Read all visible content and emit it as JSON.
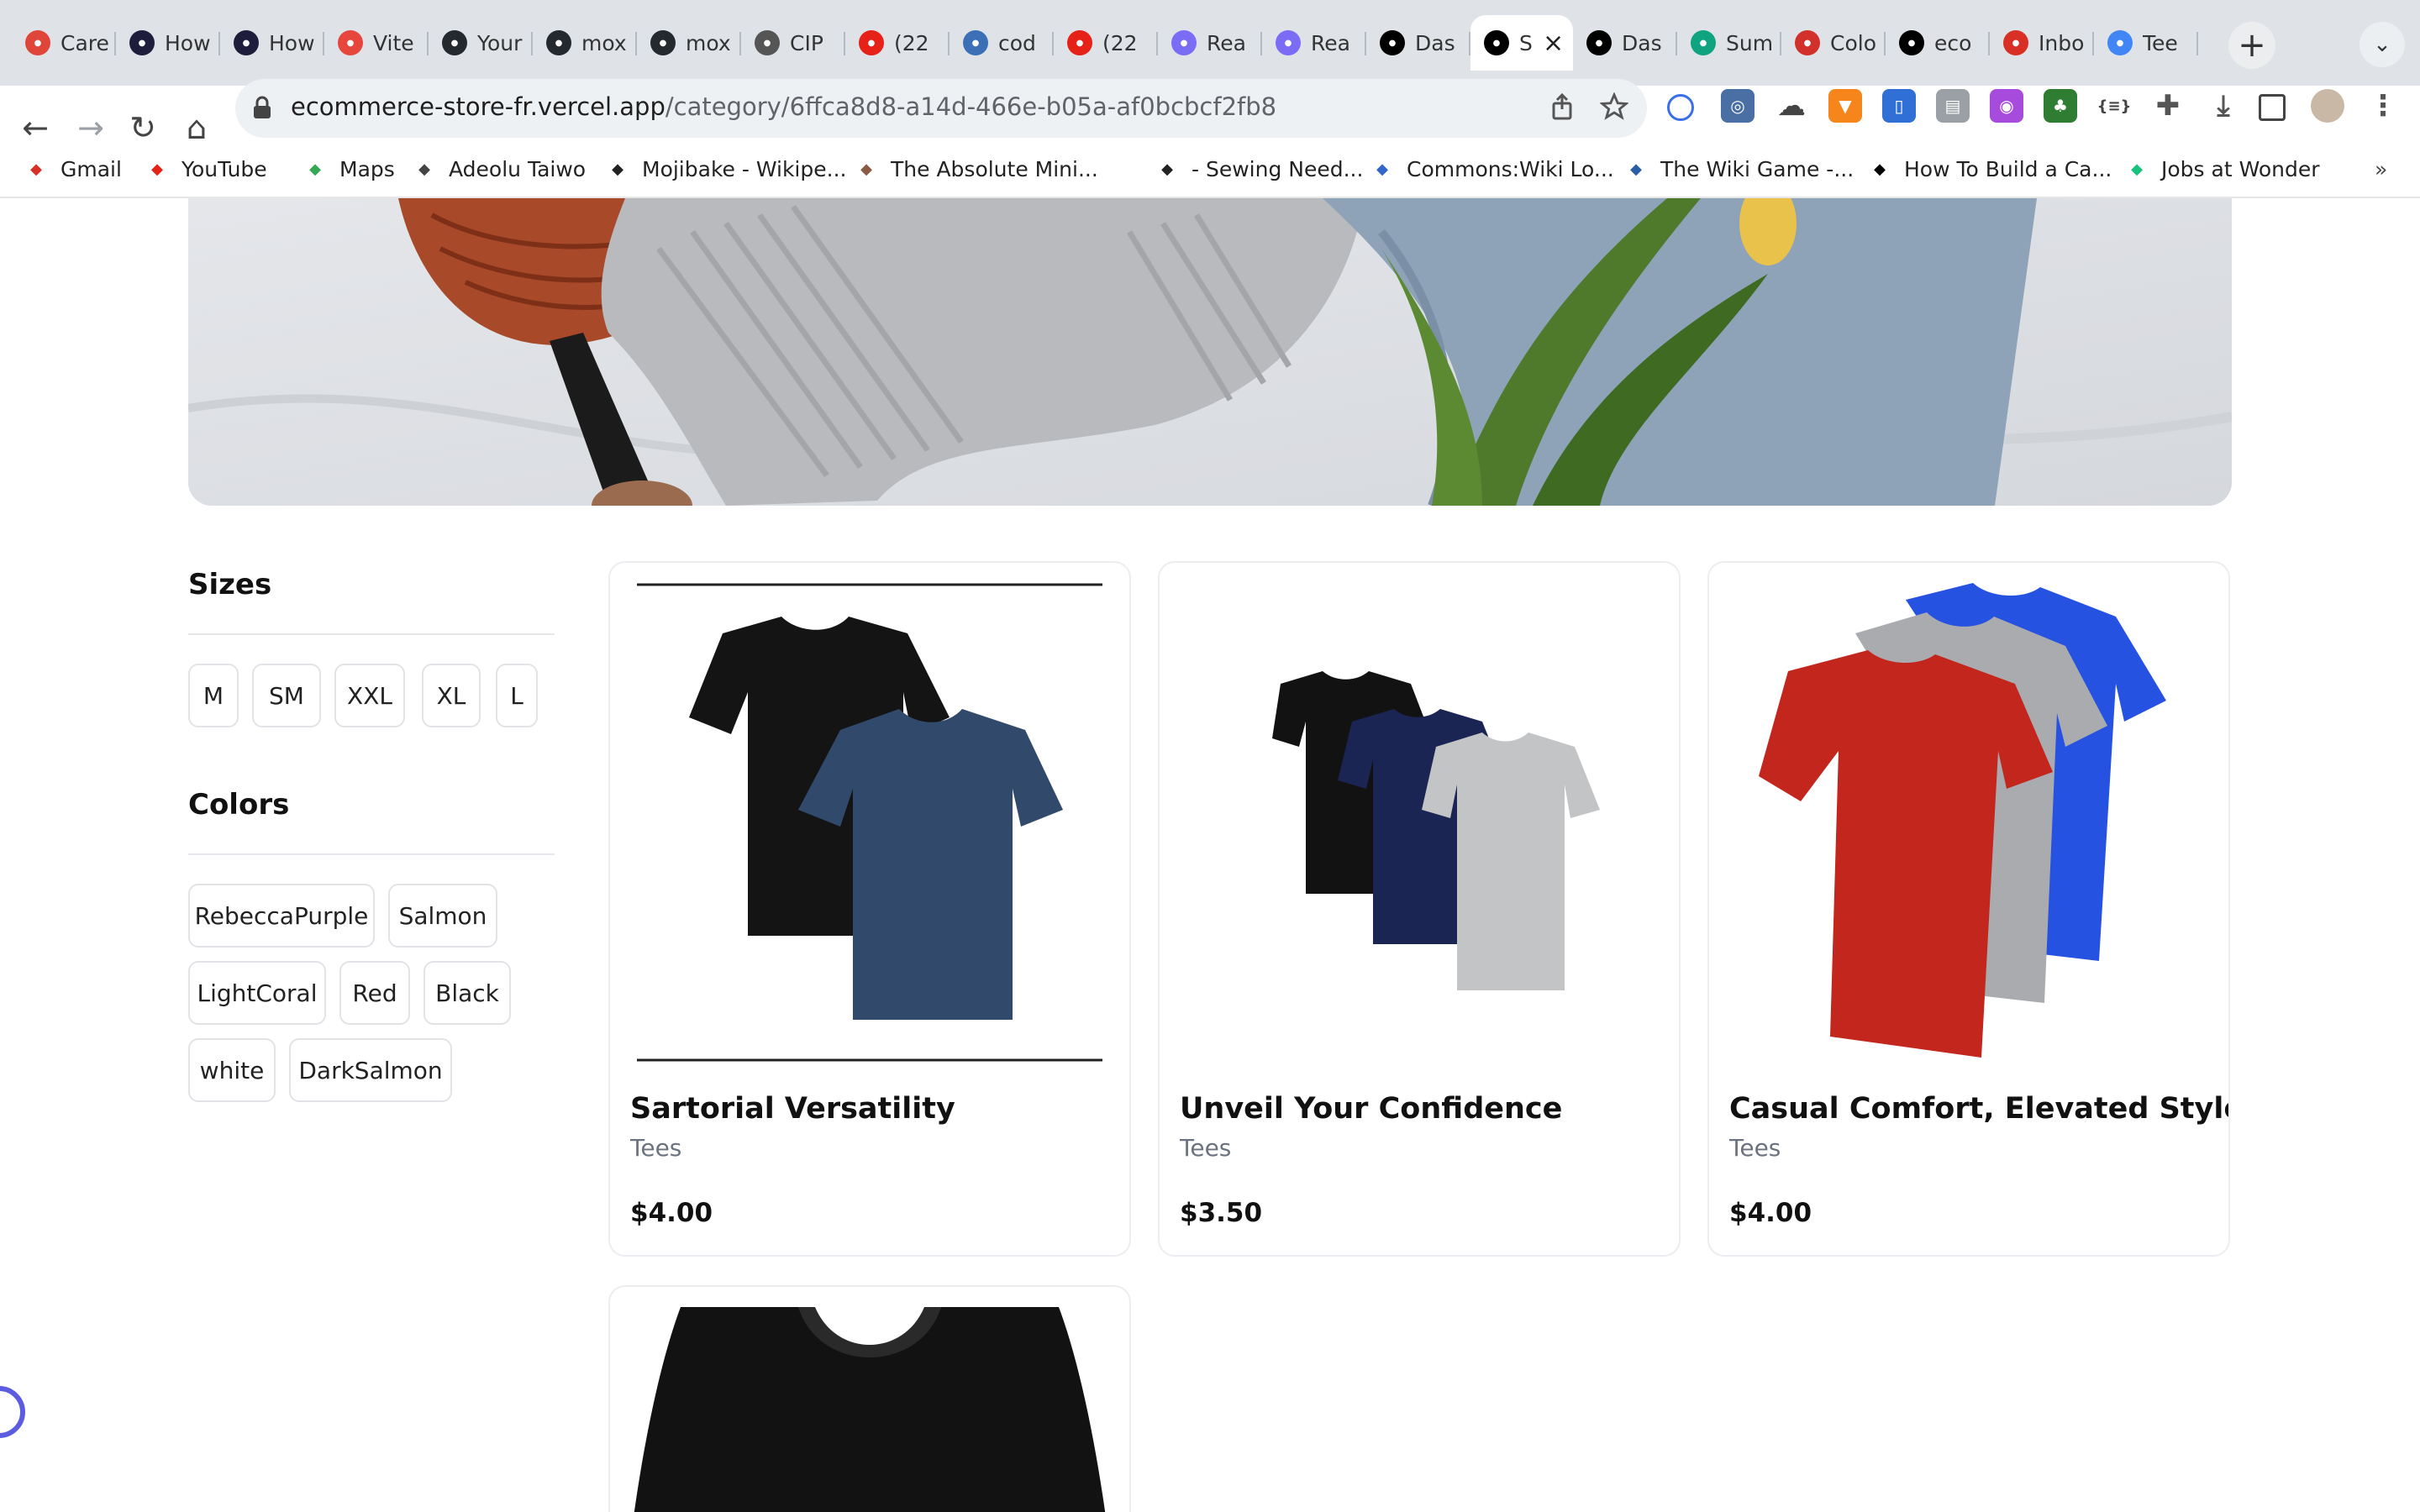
{
  "browser": {
    "tabs": [
      {
        "label": "Care",
        "icon": "care-icon",
        "color": "#e0453a"
      },
      {
        "label": "How",
        "icon": "dev-icon",
        "color": "#1e1e3c"
      },
      {
        "label": "How",
        "icon": "dev-icon",
        "color": "#1e1e3c"
      },
      {
        "label": "Vite",
        "icon": "vite-icon",
        "color": "#e6463c"
      },
      {
        "label": "Your",
        "icon": "github-icon",
        "color": "#24292f"
      },
      {
        "label": "mox",
        "icon": "github-icon",
        "color": "#24292f"
      },
      {
        "label": "mox",
        "icon": "github-icon",
        "color": "#24292f"
      },
      {
        "label": "CIP",
        "icon": "cip-icon",
        "color": "#555555"
      },
      {
        "label": "(22",
        "icon": "youtube-icon",
        "color": "#e62117"
      },
      {
        "label": "cod",
        "icon": "code-icon",
        "color": "#3b6fb6"
      },
      {
        "label": "(22",
        "icon": "youtube-icon",
        "color": "#e62117"
      },
      {
        "label": "Rea",
        "icon": "rocket-icon",
        "color": "#7b6cf5"
      },
      {
        "label": "Rea",
        "icon": "rocket-icon",
        "color": "#7b6cf5"
      },
      {
        "label": "Das",
        "icon": "vercel-icon",
        "color": "#000000"
      },
      {
        "label": "S",
        "icon": "vercel-icon",
        "color": "#000000",
        "active": true
      },
      {
        "label": "Das",
        "icon": "vercel-icon",
        "color": "#000000"
      },
      {
        "label": "Sum",
        "icon": "openai-icon",
        "color": "#10a37f"
      },
      {
        "label": "Colo",
        "icon": "color-icon",
        "color": "#d1302b"
      },
      {
        "label": "eco",
        "icon": "vercel-icon",
        "color": "#000000"
      },
      {
        "label": "Inbo",
        "icon": "gmail-icon",
        "color": "#d93025"
      },
      {
        "label": "Tee",
        "icon": "google-icon",
        "color": "#4285f4"
      }
    ],
    "url_host": "ecommerce-store-fr.vercel.app",
    "url_path": "/category/6ffca8d8-a14d-466e-b05a-af0bcbcf2fb8",
    "bookmarks": [
      {
        "label": "Gmail",
        "icon": "gmail-icon",
        "color": "#d93025"
      },
      {
        "label": "YouTube",
        "icon": "youtube-icon",
        "color": "#e62117"
      },
      {
        "label": "Maps",
        "icon": "maps-icon",
        "color": "#34a853"
      },
      {
        "label": "Adeolu Taiwo",
        "icon": "globe-icon",
        "color": "#444444"
      },
      {
        "label": "Mojibake - Wikipe...",
        "icon": "wikipedia-icon",
        "color": "#222222"
      },
      {
        "label": "The Absolute Mini...",
        "icon": "avatar-icon",
        "color": "#8a5a44"
      },
      {
        "label": "- Sewing Need...",
        "icon": "needle-icon",
        "color": "#222222"
      },
      {
        "label": "Commons:Wiki Lo...",
        "icon": "commons-icon",
        "color": "#3366cc"
      },
      {
        "label": "The Wiki Game -...",
        "icon": "wikigame-icon",
        "color": "#2a5fa8"
      },
      {
        "label": "How To Build a Ca...",
        "icon": "medium-icon",
        "color": "#000000"
      },
      {
        "label": "Jobs at Wonder",
        "icon": "wonder-icon",
        "color": "#19c37d"
      }
    ],
    "more_bookmarks": "»"
  },
  "filters": {
    "sizes_title": "Sizes",
    "sizes": [
      "M",
      "SM",
      "XXL",
      "XL",
      "L"
    ],
    "colors_title": "Colors",
    "colors": [
      "RebeccaPurple",
      "Salmon",
      "LightCoral",
      "Red",
      "Black",
      "white",
      "DarkSalmon"
    ]
  },
  "products": [
    {
      "title": "Sartorial Versatility",
      "category": "Tees",
      "price": "$4.00"
    },
    {
      "title": "Unveil Your Confidence",
      "category": "Tees",
      "price": "$3.50"
    },
    {
      "title": "Casual Comfort, Elevated Style",
      "category": "Tees",
      "price": "$4.00"
    },
    {
      "title": "",
      "category": "",
      "price": ""
    }
  ],
  "colors": {
    "chip_border": "#e1e3e7",
    "card_border": "#ebedf0",
    "muted_text": "#6b7280",
    "shirt_red": "#c4221b",
    "shirt_blue": "#2450e0",
    "shirt_navy": "#1c2756",
    "shirt_slate": "#2f4766",
    "shirt_grey": "#bfc1c4",
    "shirt_black": "#111111"
  }
}
